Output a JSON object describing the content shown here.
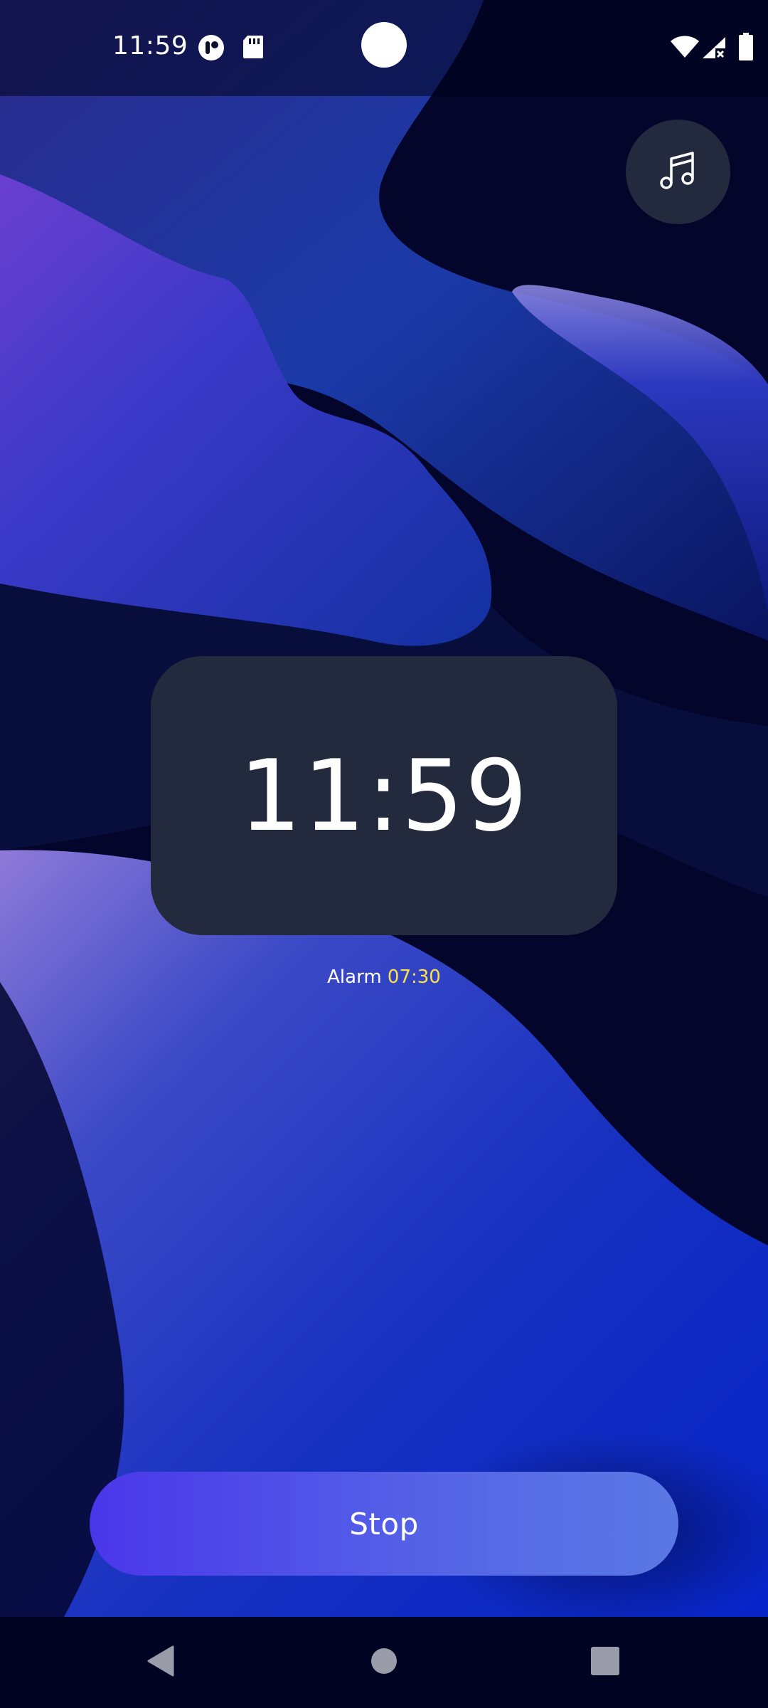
{
  "status_bar": {
    "time": "11:59",
    "icons": [
      "app-notification-icon",
      "sd-card-icon",
      "wifi-icon",
      "cellular-signal-icon",
      "battery-icon"
    ]
  },
  "music_button": {
    "icon": "music-note-icon"
  },
  "clock": {
    "time": "11:59"
  },
  "alarm": {
    "label": "Alarm",
    "time": "07:30"
  },
  "stop_button": {
    "label": "Stop"
  },
  "nav_bar": {
    "icons": [
      "back-icon",
      "home-icon",
      "recents-icon"
    ]
  },
  "colors": {
    "card": "#232a3d",
    "alarm_time": "#fde047",
    "button_start": "#4a36ea",
    "button_end": "#5a78e4",
    "text": "#ffffff"
  }
}
